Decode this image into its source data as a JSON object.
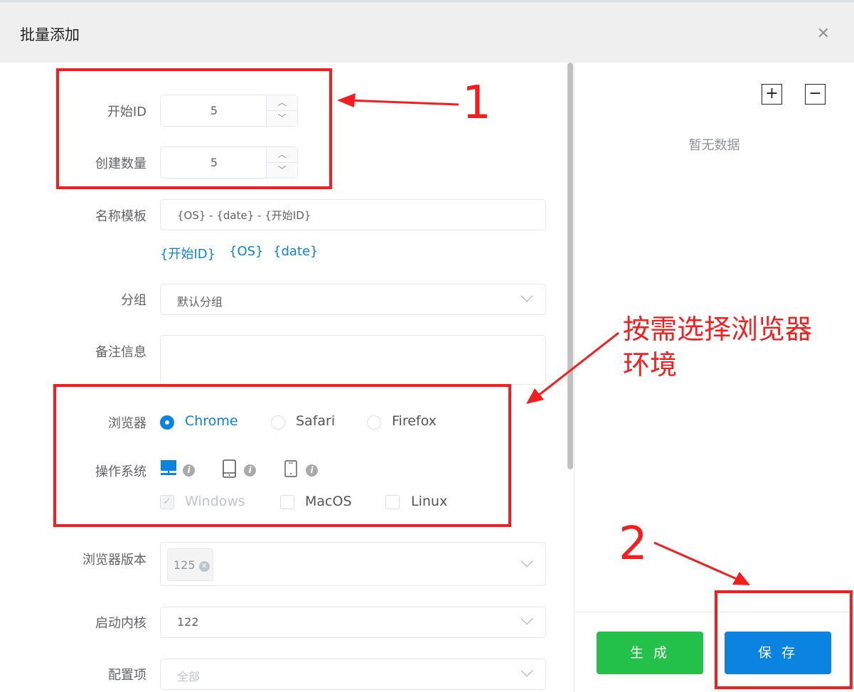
{
  "dialog": {
    "title": "批量添加",
    "close_icon": "close-icon"
  },
  "form": {
    "start_id": {
      "label": "开始ID",
      "value": "5"
    },
    "count": {
      "label": "创建数量",
      "value": "5"
    },
    "name_template": {
      "label": "名称模板",
      "value": "{OS} - {date} - {开始ID}",
      "tokens": [
        "{开始ID}",
        "{OS}",
        "{date}"
      ]
    },
    "group": {
      "label": "分组",
      "value": "默认分组"
    },
    "remark": {
      "label": "备注信息",
      "value": ""
    },
    "browser": {
      "label": "浏览器",
      "options": [
        "Chrome",
        "Safari",
        "Firefox"
      ],
      "selected": "Chrome"
    },
    "os": {
      "label": "操作系统",
      "device_icons": [
        "desktop-icon",
        "phone-icon",
        "tablet-icon"
      ],
      "options": [
        {
          "label": "Windows",
          "checked": true,
          "disabled": true
        },
        {
          "label": "MacOS",
          "checked": false
        },
        {
          "label": "Linux",
          "checked": false
        }
      ]
    },
    "browser_version": {
      "label": "浏览器版本",
      "tag": "125"
    },
    "kernel": {
      "label": "启动内核",
      "value": "122"
    },
    "config": {
      "label": "配置项",
      "placeholder": "全部"
    }
  },
  "right": {
    "empty_text": "暂无数据",
    "generate": "生 成",
    "save": "保 存"
  },
  "annotations": {
    "one": "1",
    "two": "2",
    "note": "按需选择浏览器环境",
    "color": "#f41e1e"
  },
  "colors": {
    "primary": "#0a84e0",
    "success": "#24c14a"
  }
}
